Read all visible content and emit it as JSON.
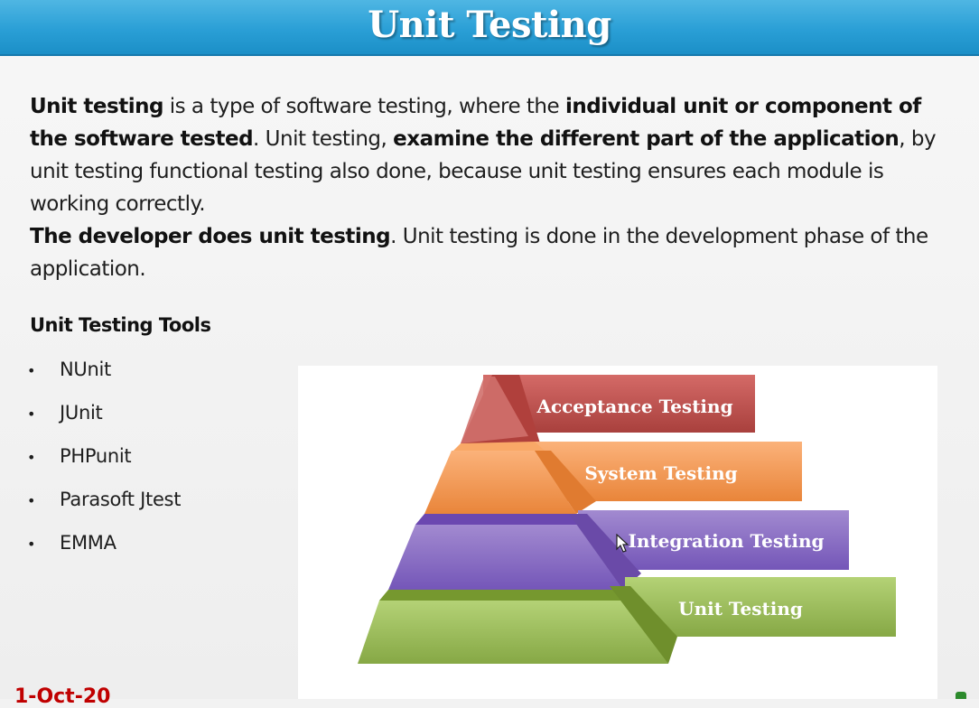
{
  "slide": {
    "title": "Unit Testing",
    "paragraph1": [
      {
        "text": "Unit testing",
        "bold": true
      },
      {
        "text": " is a type of software testing, where the ",
        "bold": false
      },
      {
        "text": "individual unit or component of the software tested",
        "bold": true
      },
      {
        "text": ". Unit testing, ",
        "bold": false
      },
      {
        "text": "examine the different part of the application",
        "bold": true
      },
      {
        "text": ", by unit testing functional testing also done, because unit testing ensures each module is working correctly.",
        "bold": false
      }
    ],
    "paragraph2": [
      {
        "text": "The developer does unit testing",
        "bold": true
      },
      {
        "text": ". Unit testing is done in the development phase of the application.",
        "bold": false
      }
    ],
    "tools_heading": "Unit Testing Tools",
    "tools": [
      "NUnit",
      "JUnit",
      "PHPunit",
      "Parasoft Jtest",
      "EMMA"
    ],
    "pyramid": {
      "levels": [
        {
          "label": "Acceptance Testing",
          "color": "#c0504d"
        },
        {
          "label": "System Testing",
          "color": "#f79646"
        },
        {
          "label": "Integration Testing",
          "color": "#8064a2"
        },
        {
          "label": "Unit Testing",
          "color": "#9bbb59"
        }
      ]
    },
    "footer_date": "1-Oct-20"
  },
  "colors": {
    "header": "#2a9fd6",
    "title_text": "#ffffff",
    "footer_date": "#c00000"
  },
  "icons": {
    "bullet": "•",
    "cursor": "mouse-pointer-icon"
  }
}
